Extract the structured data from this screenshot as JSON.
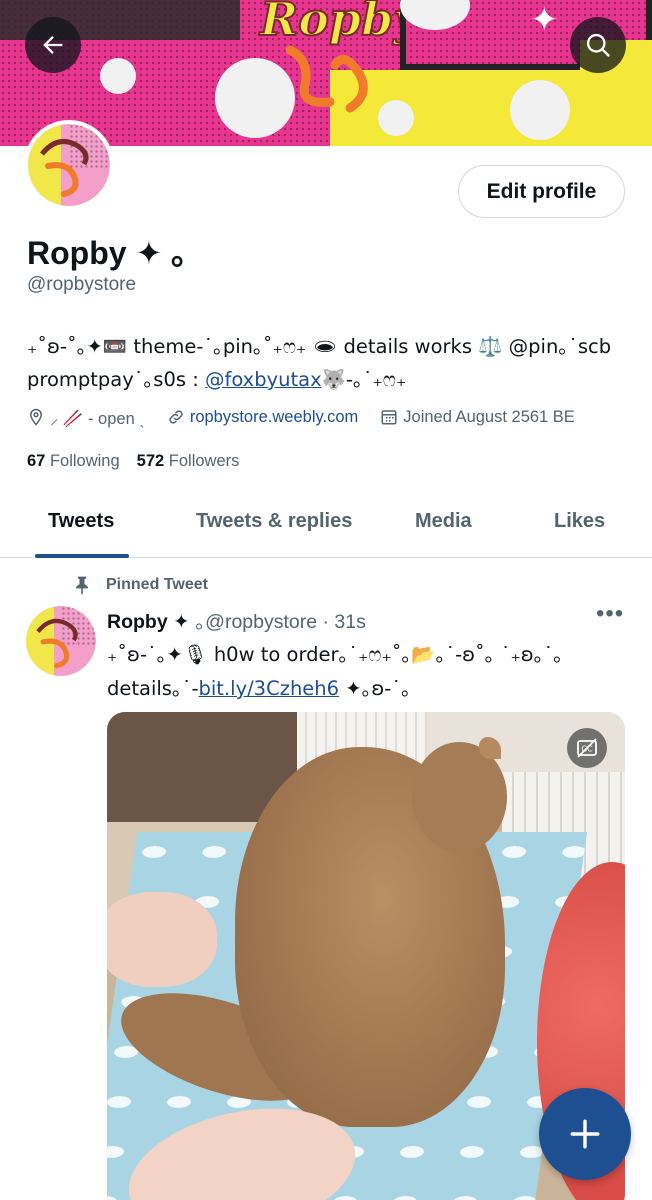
{
  "header": {
    "back_icon": "arrow-left-icon",
    "search_icon": "search-icon",
    "banner_logo_text": "Ropby"
  },
  "profile": {
    "name": "Ropby ✦ ｡",
    "handle": "@ropbystore",
    "edit_label": "Edit profile",
    "bio_part1": "₊˚ʚ-˚｡✦📼 theme-˙｡pin｡˚₊ෆ₊ 🕳 details works ⚖️ @pin｡˙scb promptpay˙｡s0s : ",
    "bio_link": "@foxbyutax",
    "bio_part2": "🐺-｡˙₊ෆ₊",
    "location": "⸝ 🥢 - open ˎ",
    "website": "ropbystore.weebly.com",
    "joined": "Joined August 2561 BE",
    "following_count": "67",
    "following_label": "Following",
    "followers_count": "572",
    "followers_label": "Followers"
  },
  "tabs": [
    {
      "label": "Tweets",
      "active": true
    },
    {
      "label": "Tweets & replies",
      "active": false
    },
    {
      "label": "Media",
      "active": false
    },
    {
      "label": "Likes",
      "active": false
    }
  ],
  "pinned_tweet": {
    "pin_label": "Pinned Tweet",
    "name": "Ropby ✦",
    "handle_time": "｡@ropbystore · 31s",
    "text_part1": "₊˚ʚ-˙｡✦🎙 h0w to order｡˙₊ෆ₊˚｡📂｡˙-ʚ˚｡ ˙₊ʚ｡˙｡details｡˙-",
    "text_link": "bit.ly/3Czheh6",
    "text_part2": " ✦｡ʚ-˙｡",
    "more_label": "•••"
  },
  "colors": {
    "accent": "#1d4f91",
    "secondary_text": "#536471",
    "banner_pink": "#e8358f",
    "banner_yellow": "#f4e838"
  },
  "fab": {
    "icon": "plus-icon"
  }
}
